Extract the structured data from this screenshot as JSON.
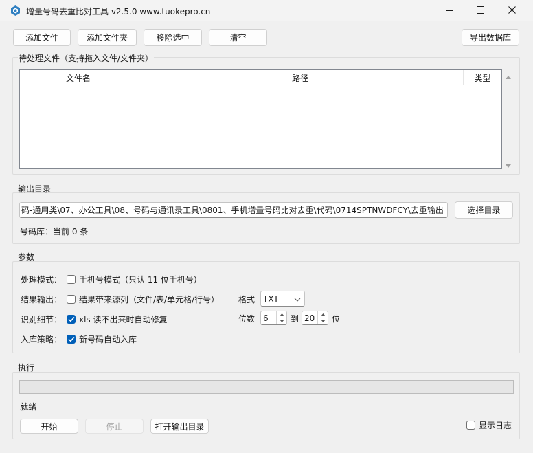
{
  "window": {
    "title": "增量号码去重比对工具 v2.5.0  www.tuokepro.cn",
    "minimize_icon": "minimize-icon",
    "maximize_icon": "maximize-icon",
    "close_icon": "close-icon"
  },
  "toolbar": {
    "add_file": "添加文件",
    "add_folder": "添加文件夹",
    "remove_selected": "移除选中",
    "clear": "清空",
    "export_db": "导出数据库"
  },
  "pending": {
    "group_title": "待处理文件（支持拖入文件/文件夹）",
    "columns": [
      "文件名",
      "路径",
      "类型"
    ],
    "rows": []
  },
  "output": {
    "group_title": "输出目录",
    "path_value": "码-通用类\\07、办公工具\\08、号码与通讯录工具\\0801、手机增量号码比对去重\\代码\\0714SPTNWDFCY\\去重输出",
    "choose_button": "选择目录",
    "db_status": "号码库：当前 0 条"
  },
  "params": {
    "group_title": "参数",
    "mode_label": "处理模式：",
    "mode_option": "手机号模式（只认 11 位手机号）",
    "mode_checked": false,
    "result_label": "结果输出：",
    "result_option": "结果带来源列（文件/表/单元格/行号）",
    "result_checked": false,
    "format_label": "格式",
    "format_value": "TXT",
    "format_options": [
      "TXT"
    ],
    "detail_label": "识别细节：",
    "detail_option": "xls 读不出来时自动修复",
    "detail_checked": true,
    "digits_label": "位数",
    "digits_min": "6",
    "digits_to": "到",
    "digits_max": "20",
    "digits_unit": "位",
    "store_label": "入库策略：",
    "store_option": "新号码自动入库",
    "store_checked": true
  },
  "execute": {
    "group_title": "执行",
    "progress": 0,
    "status": "就绪",
    "start": "开始",
    "stop": "停止",
    "open_output": "打开输出目录",
    "show_log": "显示日志",
    "show_log_checked": false
  },
  "colors": {
    "accent": "#005fb8",
    "app_icon": "#2f7fc1"
  }
}
